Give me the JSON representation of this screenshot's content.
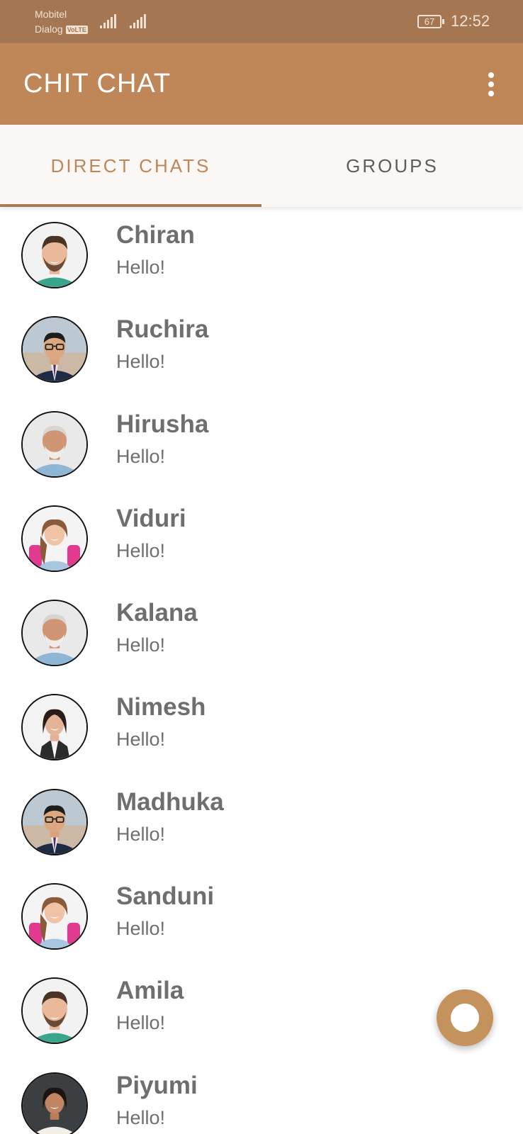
{
  "status_bar": {
    "carrier1": "Mobitel",
    "carrier2": "Dialog",
    "volte": "VoLTE",
    "battery": "67",
    "time": "12:52"
  },
  "app_bar": {
    "title": "CHIT CHAT",
    "menu_icon": "more-vert-icon"
  },
  "tabs": [
    {
      "label": "DIRECT CHATS",
      "active": true
    },
    {
      "label": "GROUPS",
      "active": false
    }
  ],
  "chats": [
    {
      "name": "Chiran",
      "message": "Hello!",
      "avatar": "man-beard"
    },
    {
      "name": "Ruchira",
      "message": "Hello!",
      "avatar": "boy-glasses"
    },
    {
      "name": "Hirusha",
      "message": "Hello!",
      "avatar": "old-man"
    },
    {
      "name": "Viduri",
      "message": "Hello!",
      "avatar": "girl-backpack"
    },
    {
      "name": "Kalana",
      "message": "Hello!",
      "avatar": "old-man"
    },
    {
      "name": "Nimesh",
      "message": "Hello!",
      "avatar": "woman-vest"
    },
    {
      "name": "Madhuka",
      "message": "Hello!",
      "avatar": "boy-glasses"
    },
    {
      "name": "Sanduni",
      "message": "Hello!",
      "avatar": "girl-backpack"
    },
    {
      "name": "Amila",
      "message": "Hello!",
      "avatar": "man-beard"
    },
    {
      "name": "Piyumi",
      "message": "Hello!",
      "avatar": "woman-dark"
    }
  ],
  "fab": {
    "icon": "circle-icon"
  },
  "colors": {
    "status_bar": "#a57652",
    "app_bar": "#bf8758",
    "tab_active": "#bf8758",
    "fab": "#c4925d"
  }
}
